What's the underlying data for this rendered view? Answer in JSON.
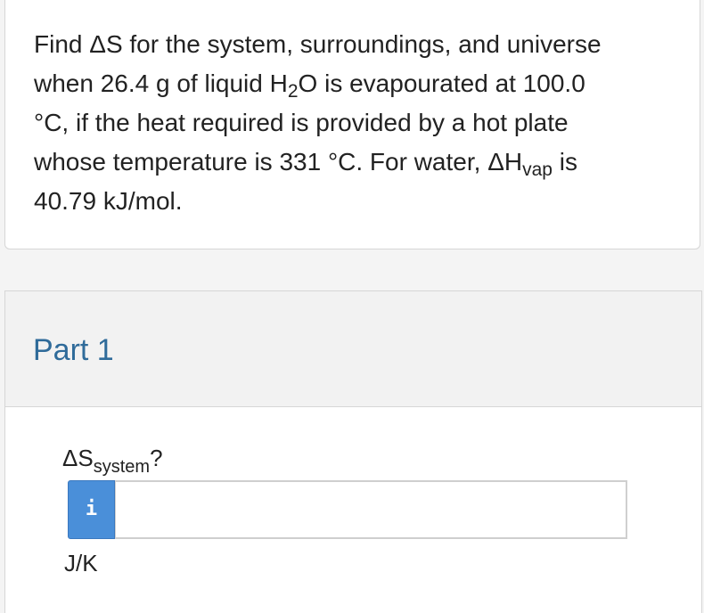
{
  "question": {
    "line1": "Find ΔS for the system, surroundings, and universe",
    "line2_prefix": "when 26.4 g of liquid H",
    "line2_sub": "2",
    "line2_suffix": "O is evapourated at 100.0",
    "line3": "°C, if the heat required is provided by a hot plate",
    "line4_prefix": "whose temperature is 331 °C. For water, ΔH",
    "line4_sub": "vap",
    "line4_suffix": " is",
    "line5": "40.79 kJ/mol."
  },
  "part": {
    "title": "Part 1",
    "prompt_prefix": "ΔS",
    "prompt_sub": "system",
    "prompt_suffix": "?",
    "info_icon_glyph": "i",
    "answer_value": "",
    "units": "J/K"
  },
  "colors": {
    "part_title": "#2f6b9a",
    "info_button": "#4a8fd9"
  },
  "icons": {
    "info": "info-icon"
  }
}
